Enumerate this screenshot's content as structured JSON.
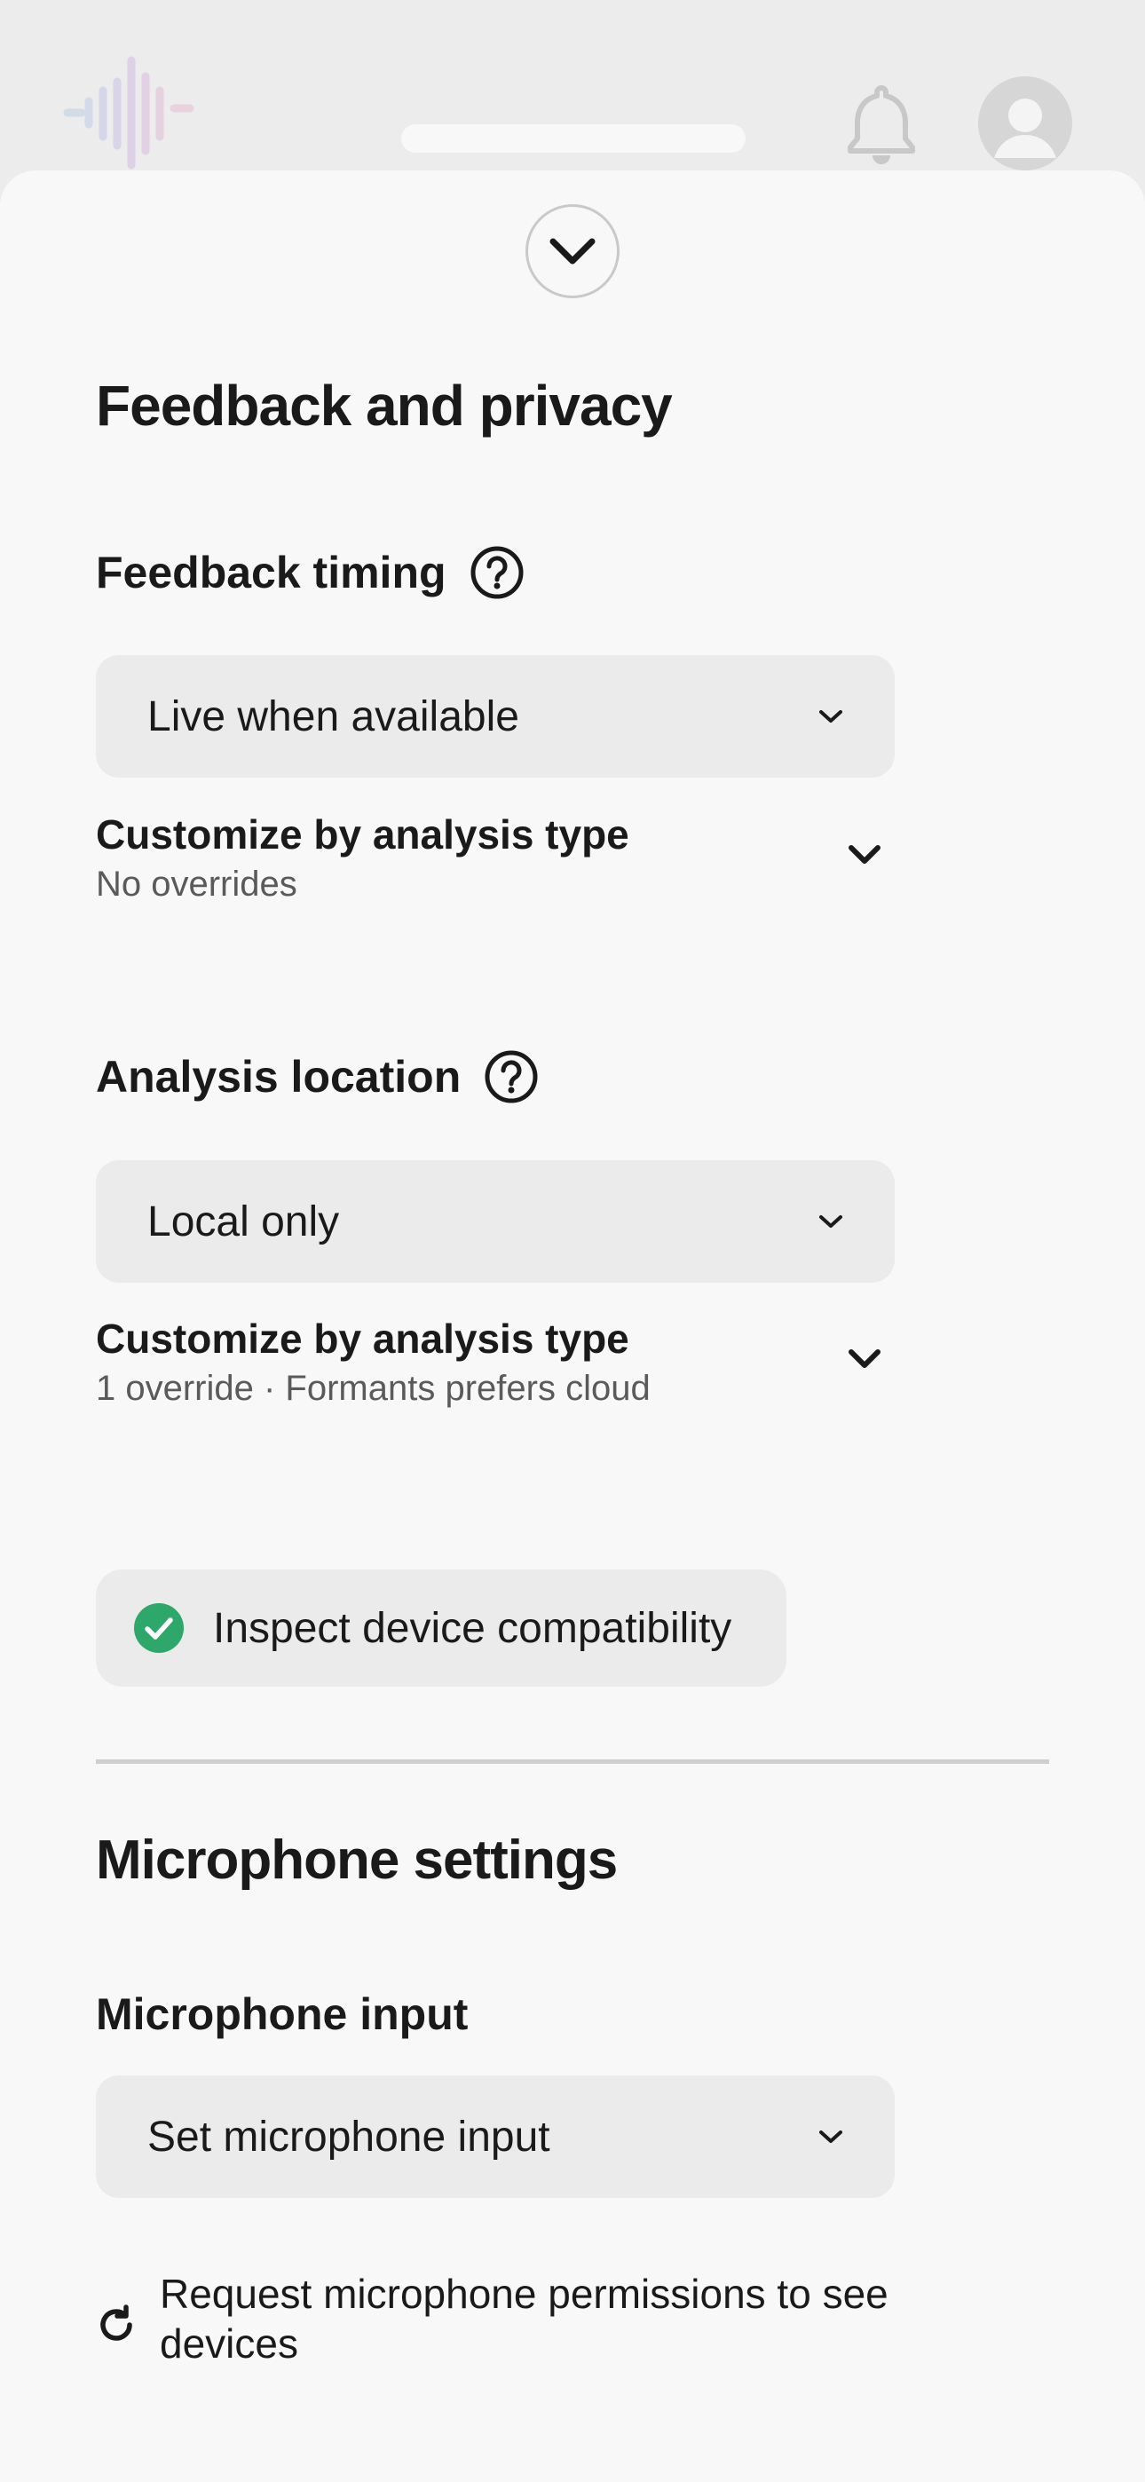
{
  "header": {
    "logo_icon": "sound-wave-logo",
    "bell_icon": "bell-icon",
    "avatar_icon": "user-avatar-icon"
  },
  "sheet": {
    "collapse_icon": "chevron-down-icon",
    "feedback_privacy": {
      "title": "Feedback and privacy",
      "feedback_timing": {
        "label": "Feedback timing",
        "selected": "Live when available",
        "customize_title": "Customize by analysis type",
        "customize_sub": "No overrides"
      },
      "analysis_location": {
        "label": "Analysis location",
        "selected": "Local only",
        "customize_title": "Customize by analysis type",
        "customize_sub": "1 override · Formants prefers cloud"
      },
      "compat_button": "Inspect device compatibility"
    },
    "microphone": {
      "title": "Microphone settings",
      "input_label": "Microphone input",
      "input_selected": "Set microphone input",
      "permissions_text": "Request microphone permissions to see devices"
    }
  },
  "colors": {
    "background": "#f8f8f8",
    "header_bg": "#ececec",
    "select_bg": "#ebebeb",
    "success_green": "#2ea86a",
    "text": "#1a1a1a",
    "muted_text": "#5a5a5a"
  }
}
